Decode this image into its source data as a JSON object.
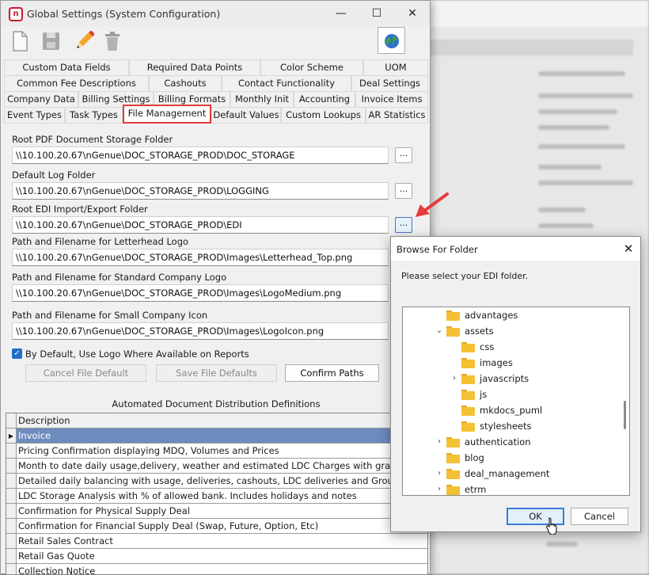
{
  "window": {
    "title": "Global Settings (System Configuration)",
    "minimize": "—",
    "maximize": "☐",
    "close": "✕"
  },
  "toolbar": {
    "icons": [
      "new-document-icon",
      "save-icon",
      "edit-pencil-icon",
      "delete-trash-icon",
      "globe-icon"
    ]
  },
  "tabs": {
    "row1": [
      "Custom Data Fields",
      "Required Data Points",
      "Color Scheme",
      "UOM"
    ],
    "row2": [
      "Common Fee Descriptions",
      "Cashouts",
      "Contact Functionality",
      "Deal Settings"
    ],
    "row3": [
      "Company Data",
      "Billing Settings",
      "Billing Formats",
      "Monthly Init",
      "Accounting",
      "Invoice Items"
    ],
    "row4": [
      "Event Types",
      "Task Types",
      "File Management",
      "Default Values",
      "Custom Lookups",
      "AR Statistics"
    ],
    "active": "File Management"
  },
  "fields": [
    {
      "label": "Root PDF Document Storage Folder",
      "value": "\\\\10.100.20.67\\nGenue\\DOC_STORAGE_PROD\\DOC_STORAGE"
    },
    {
      "label": "Default Log Folder",
      "value": "\\\\10.100.20.67\\nGenue\\DOC_STORAGE_PROD\\LOGGING"
    },
    {
      "label": "Root EDI Import/Export Folder",
      "value": "\\\\10.100.20.67\\nGenue\\DOC_STORAGE_PROD\\EDI"
    },
    {
      "label": "Path and Filename for Letterhead Logo",
      "value": "\\\\10.100.20.67\\nGenue\\DOC_STORAGE_PROD\\Images\\Letterhead_Top.png"
    },
    {
      "label": "Path and Filename for Standard Company Logo",
      "value": "\\\\10.100.20.67\\nGenue\\DOC_STORAGE_PROD\\Images\\LogoMedium.png"
    },
    {
      "label": "Path and Filename for Small Company Icon",
      "value": "\\\\10.100.20.67\\nGenue\\DOC_STORAGE_PROD\\Images\\LogoIcon.png"
    }
  ],
  "browse_label": "...",
  "checkbox": {
    "label": "By Default, Use Logo Where Available on Reports",
    "checked": true
  },
  "buttons": {
    "cancel_defaults": "Cancel File Default",
    "save_defaults": "Save File Defaults",
    "confirm_paths": "Confirm Paths"
  },
  "distribution": {
    "title": "Automated Document Distribution Definitions",
    "header": "Description",
    "rows": [
      "Invoice",
      "Pricing Confirmation displaying MDQ, Volumes and Prices",
      "Month to date daily usage,delivery, weather and estimated LDC Charges with graph",
      "Detailed daily balancing with usage, deliveries, cashouts, LDC deliveries and Group Ba",
      "LDC Storage Analysis with % of allowed bank. Includes holidays and notes",
      "Confirmation for Physical Supply Deal",
      "Confirmation for Financial Supply Deal (Swap, Future, Option, Etc)",
      "Retail Sales Contract",
      "Retail Gas Quote",
      "Collection Notice"
    ],
    "selected_row": "Invoice"
  },
  "dialog": {
    "title": "Browse For Folder",
    "close": "✕",
    "prompt": "Please select your EDI folder.",
    "tree": [
      {
        "name": "advantages",
        "chevron": ""
      },
      {
        "name": "assets",
        "chevron": "⌄"
      },
      {
        "name": "css",
        "chevron": ""
      },
      {
        "name": "images",
        "chevron": ""
      },
      {
        "name": "javascripts",
        "chevron": "›"
      },
      {
        "name": "js",
        "chevron": ""
      },
      {
        "name": "mkdocs_puml",
        "chevron": ""
      },
      {
        "name": "stylesheets",
        "chevron": ""
      },
      {
        "name": "authentication",
        "chevron": "›"
      },
      {
        "name": "blog",
        "chevron": ""
      },
      {
        "name": "deal_management",
        "chevron": "›"
      },
      {
        "name": "etrm",
        "chevron": "›"
      }
    ],
    "ok": "OK",
    "cancel": "Cancel"
  },
  "colors": {
    "highlight_red": "#e53b3b",
    "selected_row": "#6d8bbd",
    "folder_yellow": "#f4c034",
    "ok_border": "#3d7bd6"
  }
}
